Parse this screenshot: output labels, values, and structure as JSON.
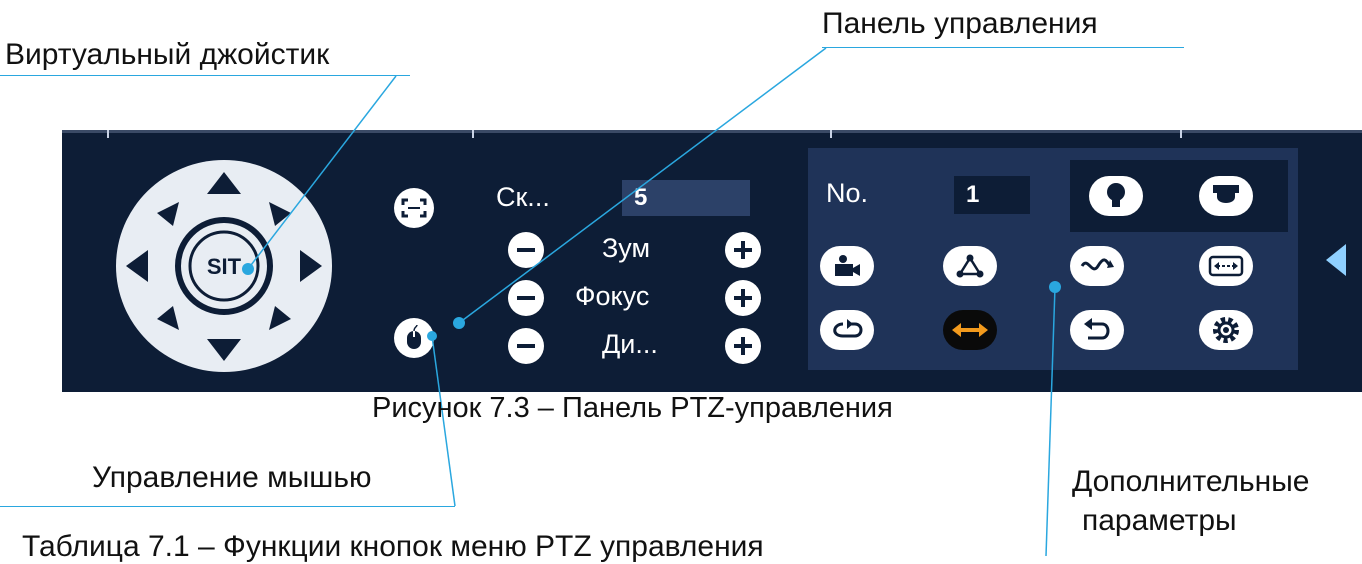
{
  "callouts": {
    "joystick": "Виртуальный джойстик",
    "control_panel": "Панель управления",
    "mouse": "Управление мышью",
    "extra_line1": "Дополнительные",
    "extra_line2": "параметры"
  },
  "figure_caption": "Рисунок 7.3 – Панель PTZ-управления",
  "table_caption": "Таблица 7.1 – Функции кнопок меню PTZ управления",
  "joystick": {
    "center_label": "SIT"
  },
  "controls": {
    "speed_label": "Ск...",
    "speed_value": "5",
    "zoom_label": "Зум",
    "focus_label": "Фокус",
    "iris_label": "Ди..."
  },
  "extra": {
    "no_label": "No.",
    "no_value": "1"
  },
  "colors": {
    "panel_bg": "#0d1d36",
    "sub_panel_bg": "#1f3358",
    "field_bg": "#2c4168",
    "callout_line": "#2aa7df",
    "active_arrow": "#f29a1d"
  }
}
